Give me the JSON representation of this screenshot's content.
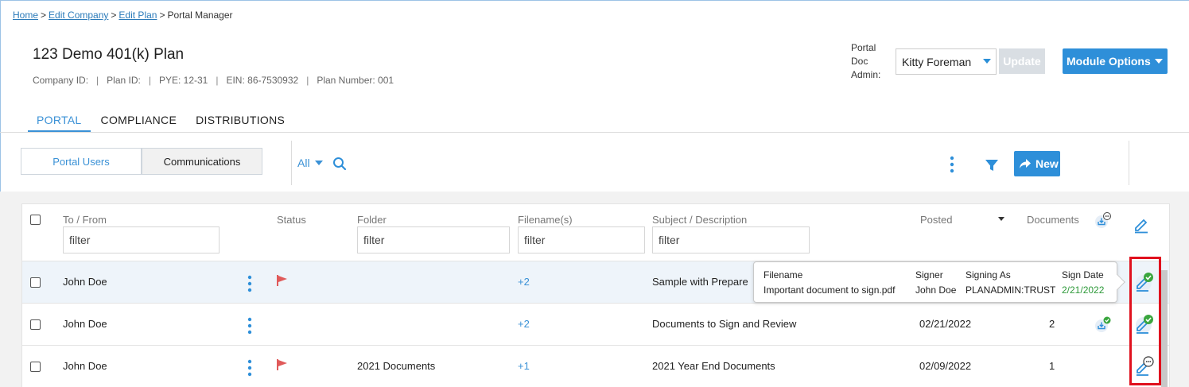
{
  "breadcrumb": {
    "home": "Home",
    "edit_company": "Edit Company",
    "edit_plan": "Edit Plan",
    "sep": ">",
    "current": "Portal Manager"
  },
  "plan": {
    "title": "123 Demo 401(k) Plan",
    "company_id": "Company ID:",
    "plan_id": "Plan ID:",
    "pye": "PYE: 12-31",
    "ein": "EIN: 86-7530932",
    "plan_number": "Plan Number: 001",
    "bar": "|"
  },
  "header": {
    "portal_doc_admin_label": [
      "Portal",
      "Doc",
      "Admin:"
    ],
    "admin_value": "Kitty Foreman",
    "update_label": "Update",
    "module_options_label": "Module Options"
  },
  "tabs": [
    "PORTAL",
    "COMPLIANCE",
    "DISTRIBUTIONS"
  ],
  "segments": [
    "Portal Users",
    "Communications"
  ],
  "toolbar": {
    "scope": "All",
    "new_label": "New"
  },
  "table": {
    "columns": {
      "to_from": "To / From",
      "status": "Status",
      "folder": "Folder",
      "filenames": "Filename(s)",
      "subject": "Subject / Description",
      "posted": "Posted",
      "documents": "Documents"
    },
    "filter_placeholder": "filter",
    "rows": [
      {
        "to_from": "John Doe",
        "flagged": true,
        "folder": "",
        "filenames": "+2",
        "subject": "Sample with Prepare",
        "posted": "",
        "documents": "",
        "doc_status": "none",
        "sign_status": "signed"
      },
      {
        "to_from": "John Doe",
        "flagged": false,
        "folder": "",
        "filenames": "+2",
        "subject": "Documents to Sign and Review",
        "posted": "02/21/2022",
        "documents": "2",
        "doc_status": "signed",
        "sign_status": "signed"
      },
      {
        "to_from": "John Doe",
        "flagged": true,
        "folder": "2021 Documents",
        "filenames": "+1",
        "subject": "2021 Year End Documents",
        "posted": "02/09/2022",
        "documents": "1",
        "doc_status": "none",
        "sign_status": "pending"
      }
    ]
  },
  "tooltip": {
    "headers": {
      "filename": "Filename",
      "signer": "Signer",
      "signing_as": "Signing As",
      "sign_date": "Sign Date"
    },
    "row": {
      "filename": "Important document to sign.pdf",
      "signer": "John Doe",
      "signing_as": "PLANADMIN:TRUST",
      "sign_date": "2/21/2022"
    }
  },
  "colors": {
    "accent": "#2e8fd9",
    "flag": "#e05a5a",
    "signed": "#3aa63e",
    "highlight": "#e0111e"
  }
}
